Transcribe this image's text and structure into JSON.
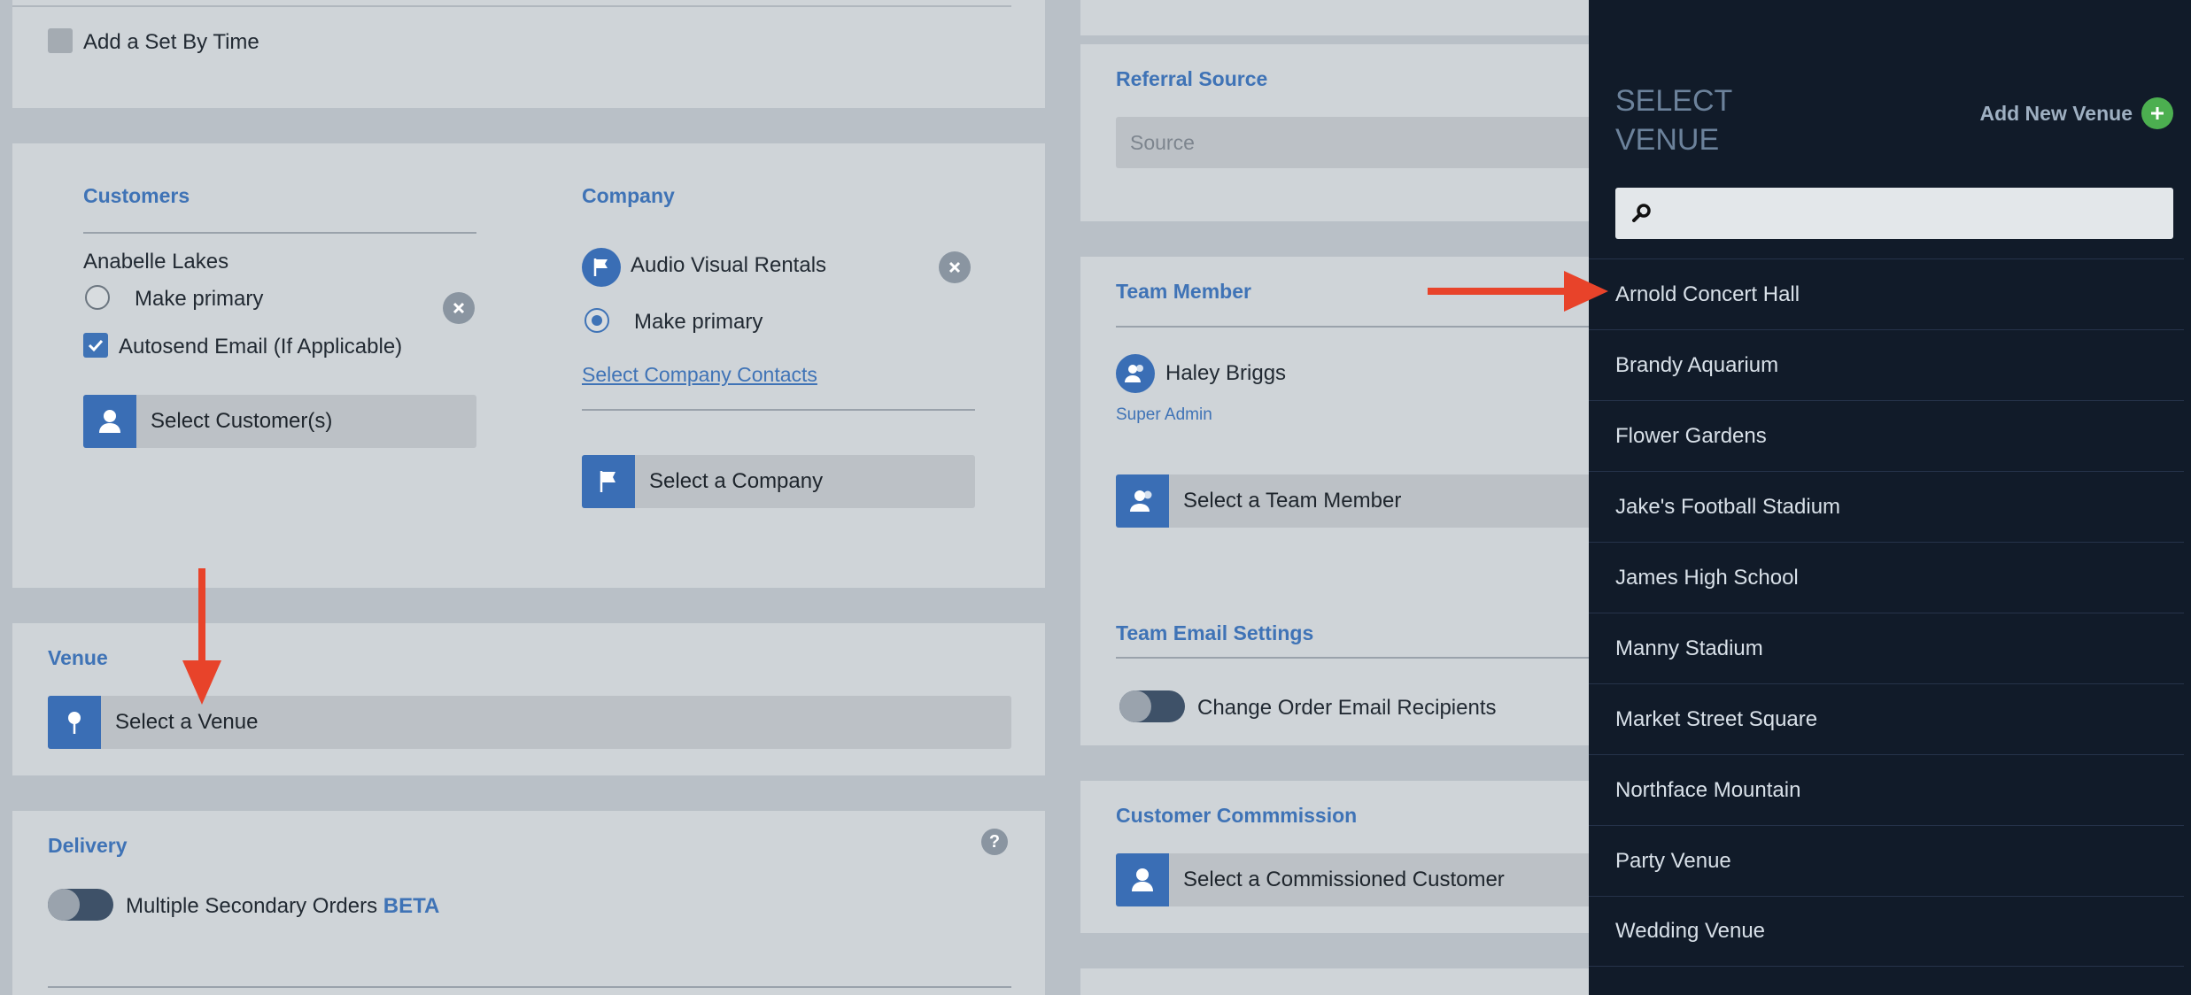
{
  "set_by_time": {
    "label": "Add a Set By Time",
    "checked": false
  },
  "customers": {
    "title": "Customers",
    "name": "Anabelle Lakes",
    "make_primary": "Make primary",
    "autosend": "Autosend Email (If Applicable)",
    "select_button": "Select Customer(s)"
  },
  "company": {
    "title": "Company",
    "name": "Audio Visual Rentals",
    "make_primary": "Make primary",
    "contacts_link": "Select Company Contacts",
    "select_button": "Select a Company"
  },
  "venue": {
    "title": "Venue",
    "select_button": "Select a Venue"
  },
  "delivery": {
    "title": "Delivery",
    "multiple_orders": "Multiple Secondary Orders",
    "beta": "BETA"
  },
  "referral": {
    "title": "Referral Source",
    "placeholder": "Source"
  },
  "team_member": {
    "title": "Team Member",
    "name": "Haley Briggs",
    "role": "Super Admin",
    "select_button": "Select a Team Member"
  },
  "team_email": {
    "title": "Team Email Settings",
    "toggle_label": "Change Order Email Recipients"
  },
  "commission": {
    "title": "Customer Commmission",
    "select_button": "Select a Commissioned Customer"
  },
  "drawer": {
    "title": "SELECT VENUE",
    "add_label": "Add New Venue",
    "search_placeholder": "",
    "venues": [
      "Arnold Concert Hall",
      "Brandy Aquarium",
      "Flower Gardens",
      "Jake's Football Stadium",
      "James High School",
      "Manny Stadium",
      "Market Street Square",
      "Northface Mountain",
      "Party Venue",
      "Wedding Venue"
    ]
  },
  "colors": {
    "accent": "#3f73b6",
    "drawer_bg": "#111b29",
    "arrow": "#e8432a",
    "add_green": "#4caf50"
  }
}
